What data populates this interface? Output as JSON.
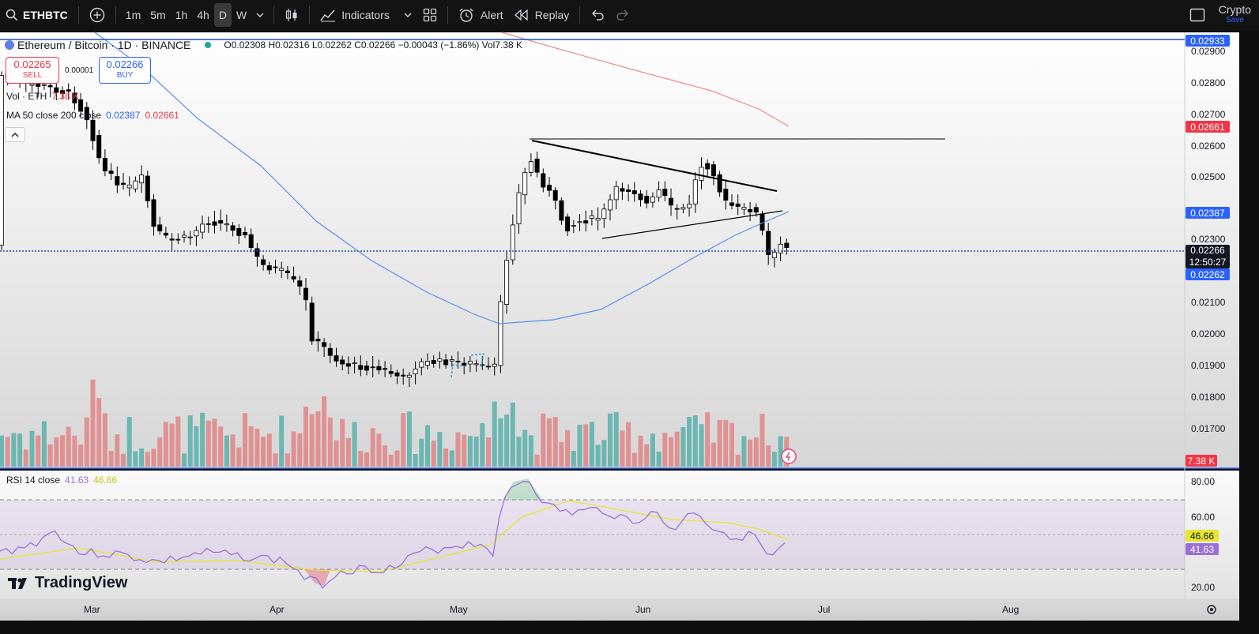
{
  "toolbar": {
    "symbol": "ETHBTC",
    "timeframes": [
      "1m",
      "5m",
      "1h",
      "4h",
      "D",
      "W"
    ],
    "active_timeframe": "D",
    "indicators_label": "Indicators",
    "alert_label": "Alert",
    "replay_label": "Replay",
    "crypto_label": "Crypto",
    "save_label": "Save"
  },
  "legend": {
    "title": "Ethereum / Bitcoin · 1D · BINANCE",
    "ohlc": "O0.02308 H0.02316 L0.02262 C0.02266 −0.00043 (−1.86%) Vol7.38 K",
    "sell_price": "0.02265",
    "sell_label": "SELL",
    "spread": "0.00001",
    "buy_price": "0.02266",
    "buy_label": "BUY",
    "vol_label": "Vol · ETH",
    "vol_value": "7.38 K",
    "ma_label": "MA 50 close 200 close",
    "ma50_value": "0.02387",
    "ma200_value": "0.02661",
    "rsi_label": "RSI 14 close",
    "rsi_value": "41.63",
    "rsi_ma_value": "46.66"
  },
  "price_axis": {
    "ticks": [
      "0.02900",
      "0.02800",
      "0.02700",
      "0.02600",
      "0.02500",
      "0.02300",
      "0.02100",
      "0.02000",
      "0.01900",
      "0.01800",
      "0.01700"
    ],
    "tags": {
      "line_top": "0.02933",
      "ma200": "0.02661",
      "ma50": "0.02387",
      "last": "0.02266",
      "countdown": "12:50:27",
      "low": "0.02262",
      "volume": "7.38 K"
    },
    "colors": {
      "blue": "#2962ff",
      "red": "#f23645",
      "dark": "#131722"
    }
  },
  "rsi_axis": {
    "ticks": [
      "80.00",
      "60.00",
      "20.00"
    ]
  },
  "time_axis": {
    "labels": [
      "Mar",
      "Apr",
      "May",
      "Jun",
      "Jul",
      "Aug"
    ]
  },
  "brand": "TradingView",
  "colors": {
    "up": "#ffffff",
    "down": "#000000",
    "vol_up": "#5fb3ad",
    "vol_down": "#e08a8a",
    "ma50": "#5b8def",
    "ma200": "#f08a8a",
    "rsi": "#9c6fd6",
    "rsi_ma": "#e6e62e"
  }
}
